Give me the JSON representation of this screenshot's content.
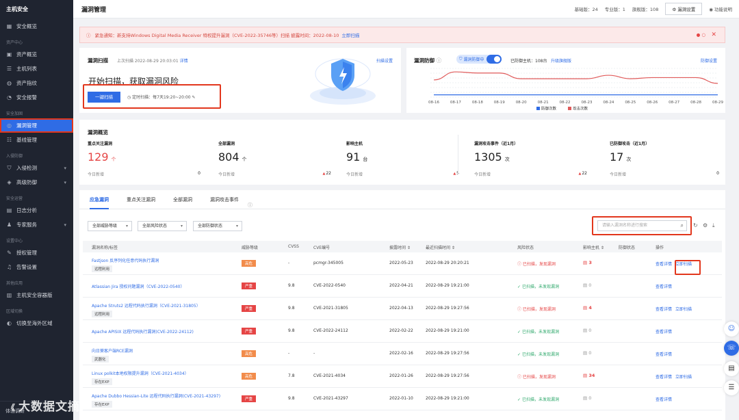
{
  "sidebar": {
    "brand": "主机安全",
    "items": [
      {
        "type": "item",
        "label": "安全概览",
        "icon": "grid-icon"
      },
      {
        "type": "group",
        "label": "资产中心"
      },
      {
        "type": "item",
        "label": "资产概览",
        "icon": "overview-icon"
      },
      {
        "type": "item",
        "label": "主机列表",
        "icon": "server-icon"
      },
      {
        "type": "item",
        "label": "资产指纹",
        "icon": "fingerprint-icon"
      },
      {
        "type": "item",
        "label": "安全报警",
        "icon": "alarm-icon"
      },
      {
        "type": "group",
        "label": "安全加固"
      },
      {
        "type": "item",
        "label": "漏洞管理",
        "icon": "target-icon",
        "active": true
      },
      {
        "type": "item",
        "label": "基线管理",
        "icon": "baseline-icon"
      },
      {
        "type": "group",
        "label": "入侵防御"
      },
      {
        "type": "item",
        "label": "入侵检测",
        "icon": "shield-icon",
        "chevron": true
      },
      {
        "type": "item",
        "label": "高级防御",
        "icon": "defense-icon",
        "chevron": true
      },
      {
        "type": "group",
        "label": "安全运营"
      },
      {
        "type": "item",
        "label": "日志分析",
        "icon": "log-icon"
      },
      {
        "type": "item",
        "label": "专家服务",
        "icon": "expert-icon",
        "chevron": true
      },
      {
        "type": "group",
        "label": "设置中心"
      },
      {
        "type": "item",
        "label": "授权管理",
        "icon": "license-icon"
      },
      {
        "type": "item",
        "label": "告警设置",
        "icon": "bell-icon"
      },
      {
        "type": "group",
        "label": "其他应用"
      },
      {
        "type": "item",
        "label": "主机安全容器版",
        "icon": "container-icon"
      },
      {
        "type": "group",
        "label": "区域切换"
      },
      {
        "type": "item",
        "label": "切换至海外区域",
        "icon": "globe-icon"
      }
    ],
    "footer": "体验调研"
  },
  "topbar": {
    "title": "漏洞管理",
    "basic": "基础版：24",
    "pro": "专业版：1",
    "flagship": "旗舰版：108",
    "settings_btn": "漏洞设置",
    "help": "功能说明"
  },
  "alert": {
    "text": "紧急通知：新支持Windows Digital Media Receiver 特权提升漏洞（CVE-2022-35746等）扫描 披露时间：2022-08-10",
    "link": "立即扫描"
  },
  "scan": {
    "title": "漏洞扫描",
    "last": "上次扫描 2022-08-29 20:03:01",
    "detail": "详情",
    "settings": "扫描设置",
    "headline": "开始扫描，获取漏洞风险",
    "button": "一键扫描",
    "schedule": "定时扫描：每7天19:20~20:00"
  },
  "defense": {
    "title": "漏洞防御",
    "toggle": "漏洞防御中",
    "hosts": "已防御主机：108台",
    "upgrade": "升级旗舰版",
    "settings": "防御设置"
  },
  "chart_data": {
    "type": "line",
    "x": [
      "08-16",
      "08-17",
      "08-18",
      "08-19",
      "08-20",
      "08-21",
      "08-22",
      "08-23",
      "08-24",
      "08-25",
      "08-26",
      "08-27",
      "08-28",
      "08-29"
    ],
    "yticks": [
      "",
      "",
      "",
      "",
      "",
      "",
      ""
    ],
    "series": [
      {
        "name": "防御次数",
        "color": "#2f6ce5",
        "values": [
          2,
          2,
          2,
          2,
          2,
          2,
          2,
          2,
          2,
          2,
          2,
          2,
          2,
          2
        ]
      },
      {
        "name": "攻击次数",
        "color": "#e05a5a",
        "values": [
          15,
          22,
          21,
          21,
          16,
          16,
          16,
          16,
          19,
          16,
          17,
          17,
          17,
          12
        ]
      }
    ],
    "ylim": [
      0,
      25
    ]
  },
  "overview": {
    "title": "漏洞概览",
    "today_label": "今日新增",
    "stats": [
      {
        "label": "重点关注漏洞",
        "num": "129",
        "unit": "个",
        "today": "0",
        "red": true,
        "up": false
      },
      {
        "label": "全部漏洞",
        "num": "804",
        "unit": "个",
        "today": "22",
        "red": false,
        "up": true
      },
      {
        "label": "影响主机",
        "num": "91",
        "unit": "台",
        "today": "5",
        "red": false,
        "up": true
      },
      {
        "label": "漏洞攻击事件（近1月）",
        "num": "1305",
        "unit": "次",
        "today": "22",
        "red": false,
        "up": true
      },
      {
        "label": "已防御攻击（近1月）",
        "num": "17",
        "unit": "次",
        "today": "0",
        "red": false,
        "up": false
      }
    ]
  },
  "tabs": [
    "应急漏洞",
    "重点关注漏洞",
    "全部漏洞",
    "漏洞攻击事件"
  ],
  "filters": [
    "全部威胁等级",
    "全部风险状态",
    "全部防御状态"
  ],
  "search_placeholder": "请输入漏洞名称进行搜索",
  "table": {
    "headers": [
      "漏洞名称/标签",
      "威胁等级",
      "CVSS",
      "CVE编号",
      "披露时间 ⇕",
      "最近扫描时间 ⇕",
      "风险状态",
      "影响主机 ⇕",
      "防御状态",
      "操作"
    ],
    "view": "查看详情",
    "scan": "立即扫描",
    "rows": [
      {
        "name": "Fastjson 反序列化任意代码执行漏洞",
        "tag": "远程利用",
        "level": "高危",
        "lv": "hi",
        "cvss": "-",
        "cve": "pcmgr-345005",
        "date": "2022-05-23",
        "scan": "2022-08-29 20:20:21",
        "risk": "已扫描，发现漏洞",
        "bad": true,
        "hosts": "3"
      },
      {
        "name": "Atlassian Jira 授权问题漏洞（CVE-2022-0540）",
        "tag": "",
        "level": "严重",
        "lv": "cr",
        "cvss": "9.8",
        "cve": "CVE-2022-0540",
        "date": "2022-04-21",
        "scan": "2022-08-29 19:21:00",
        "risk": "已扫描，未发现漏洞",
        "bad": false,
        "hosts": "0"
      },
      {
        "name": "Apache Struts2 远程代码执行漏洞（CVE-2021-31805）",
        "tag": "远程利用",
        "level": "严重",
        "lv": "cr",
        "cvss": "9.8",
        "cve": "CVE-2021-31805",
        "date": "2022-04-13",
        "scan": "2022-08-29 19:27:56",
        "risk": "已扫描，发现漏洞",
        "bad": true,
        "hosts": "4"
      },
      {
        "name": "Apache APISIX 远程代码执行漏洞(CVE-2022-24112)",
        "tag": "",
        "level": "严重",
        "lv": "cr",
        "cvss": "9.8",
        "cve": "CVE-2022-24112",
        "date": "2022-02-22",
        "scan": "2022-08-29 19:21:00",
        "risk": "已扫描，未发现漏洞",
        "bad": false,
        "hosts": "0"
      },
      {
        "name": "向日葵客户端RCE漏洞",
        "tag": "武器化",
        "level": "高危",
        "lv": "hi",
        "cvss": "-",
        "cve": "-",
        "date": "2022-02-16",
        "scan": "2022-08-29 19:27:56",
        "risk": "已扫描，未发现漏洞",
        "bad": false,
        "hosts": "0"
      },
      {
        "name": "Linux polkit本地权限提升漏洞（CVE-2021-4034）",
        "tag": "存在EXP",
        "level": "高危",
        "lv": "hi",
        "cvss": "7.8",
        "cve": "CVE-2021-4034",
        "date": "2022-01-26",
        "scan": "2022-08-29 19:27:56",
        "risk": "已扫描，发现漏洞",
        "bad": true,
        "hosts": "34"
      },
      {
        "name": "Apache Dubbo Hessian-Lite 远程代码执行漏洞(CVE-2021-43297)",
        "tag": "存在EXP",
        "level": "严重",
        "lv": "cr",
        "cvss": "9.8",
        "cve": "CVE-2021-43297",
        "date": "2022-01-10",
        "scan": "2022-08-29 19:21:00",
        "risk": "已扫描，未发现漏洞",
        "bad": false,
        "hosts": "0"
      }
    ]
  },
  "watermark": "大数据文摘"
}
